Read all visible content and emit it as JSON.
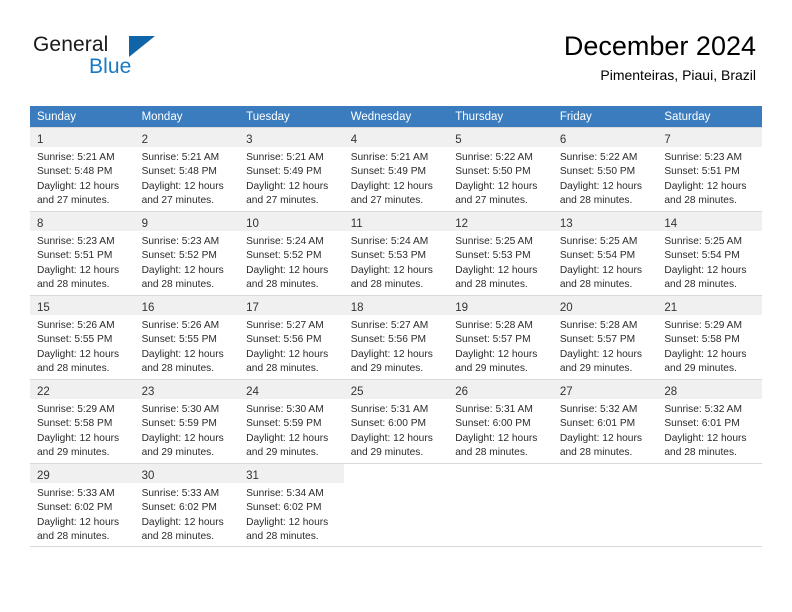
{
  "brand": {
    "name_part1": "General",
    "name_part2": "Blue",
    "accent_color": "#1b79c3",
    "triangle_color": "#1064a8"
  },
  "header": {
    "month_title": "December 2024",
    "location": "Pimenteiras, Piaui, Brazil"
  },
  "calendar": {
    "header_color": "#3a7cbe",
    "weekday_headers": [
      "Sunday",
      "Monday",
      "Tuesday",
      "Wednesday",
      "Thursday",
      "Friday",
      "Saturday"
    ],
    "weeks": [
      [
        {
          "day": "1",
          "sunrise": "Sunrise: 5:21 AM",
          "sunset": "Sunset: 5:48 PM",
          "daylight1": "Daylight: 12 hours",
          "daylight2": "and 27 minutes."
        },
        {
          "day": "2",
          "sunrise": "Sunrise: 5:21 AM",
          "sunset": "Sunset: 5:48 PM",
          "daylight1": "Daylight: 12 hours",
          "daylight2": "and 27 minutes."
        },
        {
          "day": "3",
          "sunrise": "Sunrise: 5:21 AM",
          "sunset": "Sunset: 5:49 PM",
          "daylight1": "Daylight: 12 hours",
          "daylight2": "and 27 minutes."
        },
        {
          "day": "4",
          "sunrise": "Sunrise: 5:21 AM",
          "sunset": "Sunset: 5:49 PM",
          "daylight1": "Daylight: 12 hours",
          "daylight2": "and 27 minutes."
        },
        {
          "day": "5",
          "sunrise": "Sunrise: 5:22 AM",
          "sunset": "Sunset: 5:50 PM",
          "daylight1": "Daylight: 12 hours",
          "daylight2": "and 27 minutes."
        },
        {
          "day": "6",
          "sunrise": "Sunrise: 5:22 AM",
          "sunset": "Sunset: 5:50 PM",
          "daylight1": "Daylight: 12 hours",
          "daylight2": "and 28 minutes."
        },
        {
          "day": "7",
          "sunrise": "Sunrise: 5:23 AM",
          "sunset": "Sunset: 5:51 PM",
          "daylight1": "Daylight: 12 hours",
          "daylight2": "and 28 minutes."
        }
      ],
      [
        {
          "day": "8",
          "sunrise": "Sunrise: 5:23 AM",
          "sunset": "Sunset: 5:51 PM",
          "daylight1": "Daylight: 12 hours",
          "daylight2": "and 28 minutes."
        },
        {
          "day": "9",
          "sunrise": "Sunrise: 5:23 AM",
          "sunset": "Sunset: 5:52 PM",
          "daylight1": "Daylight: 12 hours",
          "daylight2": "and 28 minutes."
        },
        {
          "day": "10",
          "sunrise": "Sunrise: 5:24 AM",
          "sunset": "Sunset: 5:52 PM",
          "daylight1": "Daylight: 12 hours",
          "daylight2": "and 28 minutes."
        },
        {
          "day": "11",
          "sunrise": "Sunrise: 5:24 AM",
          "sunset": "Sunset: 5:53 PM",
          "daylight1": "Daylight: 12 hours",
          "daylight2": "and 28 minutes."
        },
        {
          "day": "12",
          "sunrise": "Sunrise: 5:25 AM",
          "sunset": "Sunset: 5:53 PM",
          "daylight1": "Daylight: 12 hours",
          "daylight2": "and 28 minutes."
        },
        {
          "day": "13",
          "sunrise": "Sunrise: 5:25 AM",
          "sunset": "Sunset: 5:54 PM",
          "daylight1": "Daylight: 12 hours",
          "daylight2": "and 28 minutes."
        },
        {
          "day": "14",
          "sunrise": "Sunrise: 5:25 AM",
          "sunset": "Sunset: 5:54 PM",
          "daylight1": "Daylight: 12 hours",
          "daylight2": "and 28 minutes."
        }
      ],
      [
        {
          "day": "15",
          "sunrise": "Sunrise: 5:26 AM",
          "sunset": "Sunset: 5:55 PM",
          "daylight1": "Daylight: 12 hours",
          "daylight2": "and 28 minutes."
        },
        {
          "day": "16",
          "sunrise": "Sunrise: 5:26 AM",
          "sunset": "Sunset: 5:55 PM",
          "daylight1": "Daylight: 12 hours",
          "daylight2": "and 28 minutes."
        },
        {
          "day": "17",
          "sunrise": "Sunrise: 5:27 AM",
          "sunset": "Sunset: 5:56 PM",
          "daylight1": "Daylight: 12 hours",
          "daylight2": "and 28 minutes."
        },
        {
          "day": "18",
          "sunrise": "Sunrise: 5:27 AM",
          "sunset": "Sunset: 5:56 PM",
          "daylight1": "Daylight: 12 hours",
          "daylight2": "and 29 minutes."
        },
        {
          "day": "19",
          "sunrise": "Sunrise: 5:28 AM",
          "sunset": "Sunset: 5:57 PM",
          "daylight1": "Daylight: 12 hours",
          "daylight2": "and 29 minutes."
        },
        {
          "day": "20",
          "sunrise": "Sunrise: 5:28 AM",
          "sunset": "Sunset: 5:57 PM",
          "daylight1": "Daylight: 12 hours",
          "daylight2": "and 29 minutes."
        },
        {
          "day": "21",
          "sunrise": "Sunrise: 5:29 AM",
          "sunset": "Sunset: 5:58 PM",
          "daylight1": "Daylight: 12 hours",
          "daylight2": "and 29 minutes."
        }
      ],
      [
        {
          "day": "22",
          "sunrise": "Sunrise: 5:29 AM",
          "sunset": "Sunset: 5:58 PM",
          "daylight1": "Daylight: 12 hours",
          "daylight2": "and 29 minutes."
        },
        {
          "day": "23",
          "sunrise": "Sunrise: 5:30 AM",
          "sunset": "Sunset: 5:59 PM",
          "daylight1": "Daylight: 12 hours",
          "daylight2": "and 29 minutes."
        },
        {
          "day": "24",
          "sunrise": "Sunrise: 5:30 AM",
          "sunset": "Sunset: 5:59 PM",
          "daylight1": "Daylight: 12 hours",
          "daylight2": "and 29 minutes."
        },
        {
          "day": "25",
          "sunrise": "Sunrise: 5:31 AM",
          "sunset": "Sunset: 6:00 PM",
          "daylight1": "Daylight: 12 hours",
          "daylight2": "and 29 minutes."
        },
        {
          "day": "26",
          "sunrise": "Sunrise: 5:31 AM",
          "sunset": "Sunset: 6:00 PM",
          "daylight1": "Daylight: 12 hours",
          "daylight2": "and 28 minutes."
        },
        {
          "day": "27",
          "sunrise": "Sunrise: 5:32 AM",
          "sunset": "Sunset: 6:01 PM",
          "daylight1": "Daylight: 12 hours",
          "daylight2": "and 28 minutes."
        },
        {
          "day": "28",
          "sunrise": "Sunrise: 5:32 AM",
          "sunset": "Sunset: 6:01 PM",
          "daylight1": "Daylight: 12 hours",
          "daylight2": "and 28 minutes."
        }
      ],
      [
        {
          "day": "29",
          "sunrise": "Sunrise: 5:33 AM",
          "sunset": "Sunset: 6:02 PM",
          "daylight1": "Daylight: 12 hours",
          "daylight2": "and 28 minutes."
        },
        {
          "day": "30",
          "sunrise": "Sunrise: 5:33 AM",
          "sunset": "Sunset: 6:02 PM",
          "daylight1": "Daylight: 12 hours",
          "daylight2": "and 28 minutes."
        },
        {
          "day": "31",
          "sunrise": "Sunrise: 5:34 AM",
          "sunset": "Sunset: 6:02 PM",
          "daylight1": "Daylight: 12 hours",
          "daylight2": "and 28 minutes."
        },
        {
          "day": "",
          "sunrise": "",
          "sunset": "",
          "daylight1": "",
          "daylight2": ""
        },
        {
          "day": "",
          "sunrise": "",
          "sunset": "",
          "daylight1": "",
          "daylight2": ""
        },
        {
          "day": "",
          "sunrise": "",
          "sunset": "",
          "daylight1": "",
          "daylight2": ""
        },
        {
          "day": "",
          "sunrise": "",
          "sunset": "",
          "daylight1": "",
          "daylight2": ""
        }
      ]
    ]
  }
}
